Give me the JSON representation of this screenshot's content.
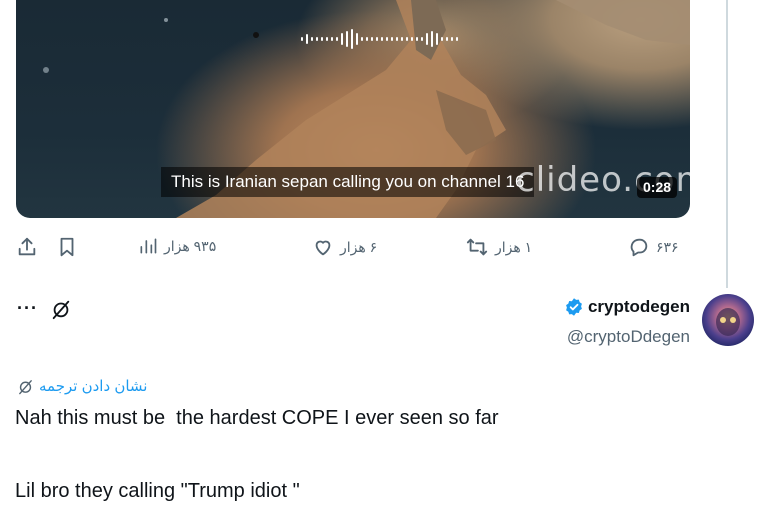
{
  "video": {
    "caption": "This is Iranian sepan calling you on channel 16",
    "watermark": "clideo.com",
    "duration": "0:28"
  },
  "actions": {
    "replies": "۶۳۶",
    "retweets": "۱ هزار",
    "likes": "۶ هزار",
    "views": "۹۳۵ هزار"
  },
  "tweet": {
    "display_name": "cryptodegen",
    "handle": "@cryptoDdegen",
    "more_label": "···",
    "translate_label": "نشان دادن ترجمه",
    "text_line1": "Nah this must be  the hardest COPE I ever seen so far",
    "text_line2": "Lil bro they calling \"Trump idiot \""
  },
  "colors": {
    "accent": "#1d9bf0",
    "secondary_text": "#536471",
    "verified": "#1d9bf0"
  },
  "icons": [
    "share-icon",
    "bookmark-icon",
    "views-icon",
    "like-icon",
    "retweet-icon",
    "reply-icon",
    "verified-icon",
    "grok-icon",
    "translate-icon"
  ]
}
